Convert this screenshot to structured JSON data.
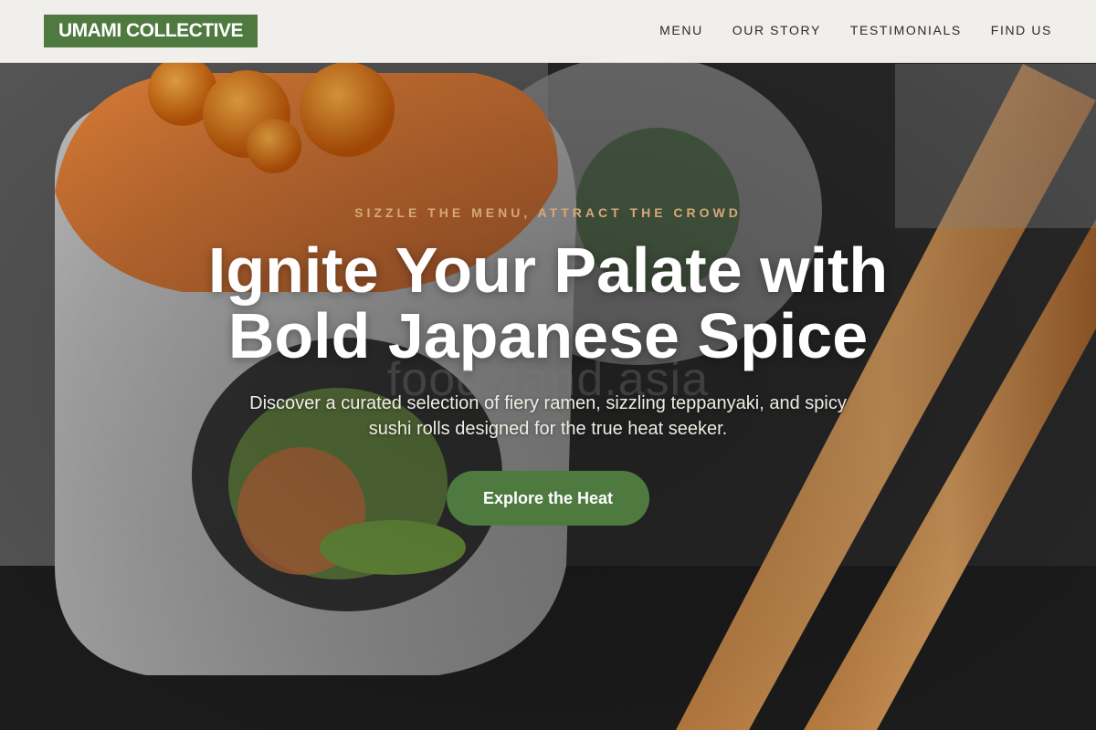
{
  "header": {
    "logo": "UMAMI COLLECTIVE",
    "nav": [
      {
        "label": "MENU"
      },
      {
        "label": "OUR STORY"
      },
      {
        "label": "TESTIMONIALS"
      },
      {
        "label": "FIND US"
      }
    ]
  },
  "hero": {
    "eyebrow": "SIZZLE THE MENU, ATTRACT THE CROWD",
    "headline": "Ignite Your Palate with Bold Japanese Spice",
    "watermark": "foodstand.asia",
    "subtext": "Discover a curated selection of fiery ramen, sizzling teppanyaki, and spicy sushi rolls designed for the true heat seeker.",
    "cta_label": "Explore the Heat",
    "background_image": "sushi-roll-with-chopsticks-photo"
  },
  "colors": {
    "brand_green": "#4f7a3f",
    "eyebrow_tan": "#d7a877",
    "header_bg": "#f8f6f2"
  }
}
